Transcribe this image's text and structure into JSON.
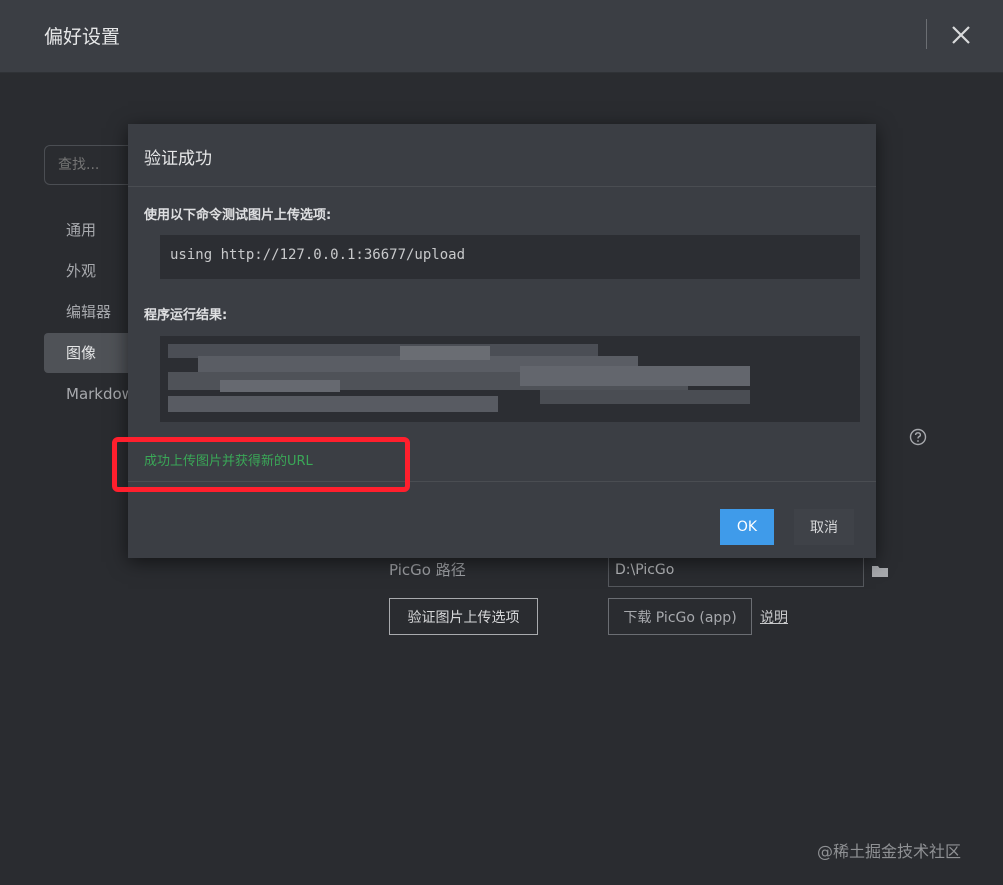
{
  "window": {
    "title": "偏好设置"
  },
  "search": {
    "placeholder": "查找..."
  },
  "sidebar": {
    "items": [
      {
        "label": "通用"
      },
      {
        "label": "外观"
      },
      {
        "label": "编辑器"
      },
      {
        "label": "图像",
        "active": true
      },
      {
        "label": "Markdown"
      }
    ]
  },
  "settings": {
    "picgo_path_label": "PicGo 路径",
    "picgo_path_value": "D:\\PicGo",
    "verify_button": "验证图片上传选项",
    "download_button": "下载 PicGo (app)",
    "explain_link": "说明"
  },
  "dialog": {
    "title": "验证成功",
    "command_label": "使用以下命令测试图片上传选项:",
    "command": "using http://127.0.0.1:36677/upload",
    "result_label": "程序运行结果:",
    "success_text": "成功上传图片并获得新的URL",
    "ok_button": "OK",
    "cancel_button": "取消"
  },
  "watermark": "@稀土掘金技术社区",
  "colors": {
    "accent": "#3f9bea",
    "success": "#3aa757",
    "highlight": "#ff1f2d"
  }
}
